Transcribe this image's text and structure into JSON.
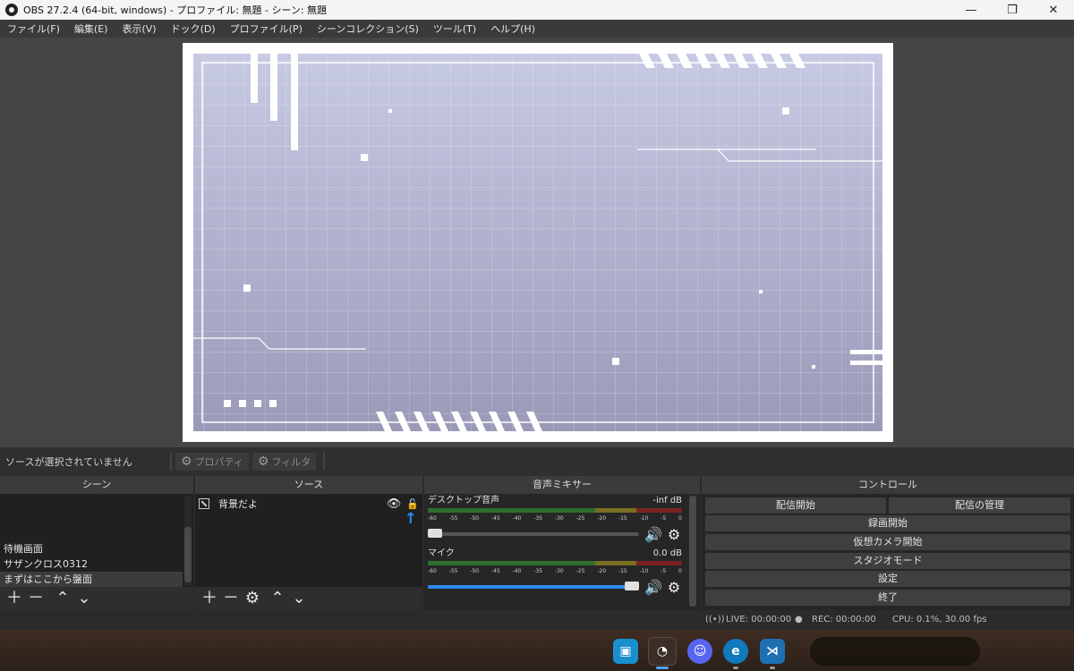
{
  "window": {
    "title": "OBS 27.2.4 (64-bit, windows) - プロファイル: 無題 - シーン: 無題",
    "minimize": "—",
    "restore": "❐",
    "close": "✕"
  },
  "menu": [
    "ファイル(F)",
    "編集(E)",
    "表示(V)",
    "ドック(D)",
    "プロファイル(P)",
    "シーンコレクション(S)",
    "ツール(T)",
    "ヘルプ(H)"
  ],
  "source_toolbar": {
    "no_selection": "ソースが選択されていません",
    "properties": "プロパティ",
    "filters": "フィルタ"
  },
  "scenes": {
    "header": "シーン",
    "items": [
      "待機画面",
      "サザンクロス0312",
      "まずはここから盤面"
    ],
    "selected_index": 2
  },
  "sources": {
    "header": "ソース",
    "items": [
      {
        "name": "背景だよ"
      }
    ]
  },
  "mixer": {
    "header": "音声ミキサー",
    "ticks": [
      "-60",
      "-55",
      "-50",
      "-45",
      "-40",
      "-35",
      "-30",
      "-25",
      "-20",
      "-15",
      "-10",
      "-5",
      "0"
    ],
    "tracks": [
      {
        "name": "デスクトップ音声",
        "level": "-inf dB",
        "volume_fraction": 0.0
      },
      {
        "name": "マイク",
        "level": "0.0 dB",
        "volume_fraction": 1.0
      }
    ]
  },
  "controls": {
    "header": "コントロール",
    "start_streaming": "配信開始",
    "manage_broadcast": "配信の管理",
    "start_recording": "録画開始",
    "start_virtual_camera": "仮想カメラ開始",
    "studio_mode": "スタジオモード",
    "settings": "設定",
    "exit": "終了"
  },
  "status": {
    "live": "LIVE: 00:00:00",
    "rec": "REC: 00:00:00",
    "cpu": "CPU: 0.1%, 30.00 fps"
  },
  "taskbar": {
    "apps": [
      "camera-app-icon",
      "obs-app-icon",
      "discord-app-icon",
      "edge-app-icon",
      "vscode-app-icon"
    ]
  },
  "colors": {
    "accent": "#2a8cf0",
    "canvas_frame": "#ffffff",
    "canvas_bg_top": "#c7cae3",
    "canvas_bg_bottom": "#9a9ab8",
    "meter_green": "#3fae3f",
    "meter_yellow": "#b8a82e",
    "meter_red": "#b83232"
  }
}
